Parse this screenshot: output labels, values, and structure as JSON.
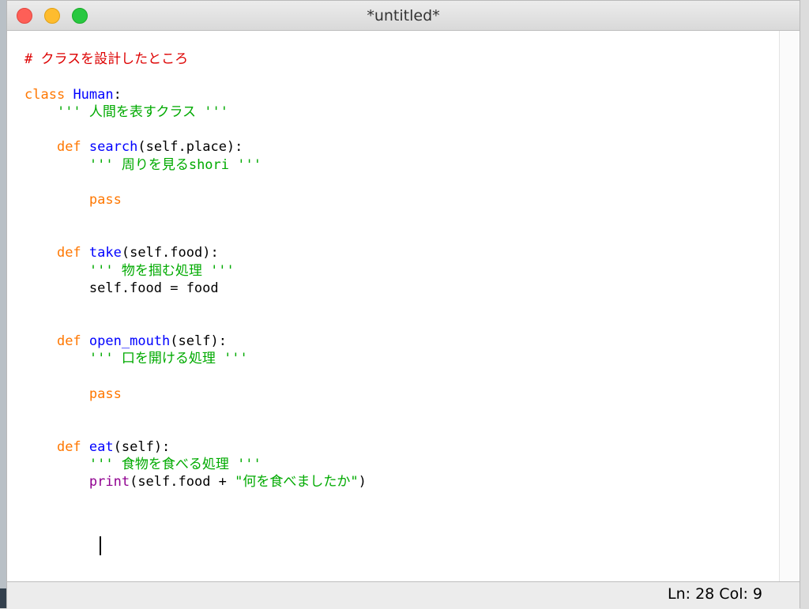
{
  "window": {
    "title": "*untitled*"
  },
  "editor": {
    "lines": [
      [
        {
          "t": "# クラスを設計したところ",
          "c": "com"
        }
      ],
      [],
      [
        {
          "t": "class",
          "c": "kw"
        },
        {
          "t": " "
        },
        {
          "t": "Human",
          "c": "name"
        },
        {
          "t": ":"
        }
      ],
      [
        {
          "t": "    "
        },
        {
          "t": "''' 人間を表すクラス '''",
          "c": "str"
        }
      ],
      [],
      [
        {
          "t": "    "
        },
        {
          "t": "def",
          "c": "kw"
        },
        {
          "t": " "
        },
        {
          "t": "search",
          "c": "name"
        },
        {
          "t": "(self.place):"
        }
      ],
      [
        {
          "t": "        "
        },
        {
          "t": "''' 周りを見るshori '''",
          "c": "str"
        }
      ],
      [],
      [
        {
          "t": "        "
        },
        {
          "t": "pass",
          "c": "kw"
        }
      ],
      [],
      [],
      [
        {
          "t": "    "
        },
        {
          "t": "def",
          "c": "kw"
        },
        {
          "t": " "
        },
        {
          "t": "take",
          "c": "name"
        },
        {
          "t": "(self.food):"
        }
      ],
      [
        {
          "t": "        "
        },
        {
          "t": "''' 物を掴む処理 '''",
          "c": "str"
        }
      ],
      [
        {
          "t": "        self.food = food"
        }
      ],
      [],
      [],
      [
        {
          "t": "    "
        },
        {
          "t": "def",
          "c": "kw"
        },
        {
          "t": " "
        },
        {
          "t": "open_mouth",
          "c": "name"
        },
        {
          "t": "(self):"
        }
      ],
      [
        {
          "t": "        "
        },
        {
          "t": "''' 口を開ける処理 '''",
          "c": "str"
        }
      ],
      [],
      [
        {
          "t": "        "
        },
        {
          "t": "pass",
          "c": "kw"
        }
      ],
      [],
      [],
      [
        {
          "t": "    "
        },
        {
          "t": "def",
          "c": "kw"
        },
        {
          "t": " "
        },
        {
          "t": "eat",
          "c": "name"
        },
        {
          "t": "(self):"
        }
      ],
      [
        {
          "t": "        "
        },
        {
          "t": "''' 食物を食べる処理 '''",
          "c": "str"
        }
      ],
      [
        {
          "t": "        "
        },
        {
          "t": "print",
          "c": "bi"
        },
        {
          "t": "(self.food + "
        },
        {
          "t": "\"何を食べましたか\"",
          "c": "str"
        },
        {
          "t": ")"
        }
      ],
      [],
      [
        {
          "t": "        "
        }
      ]
    ]
  },
  "status": {
    "text": "Ln: 28  Col: 9"
  }
}
